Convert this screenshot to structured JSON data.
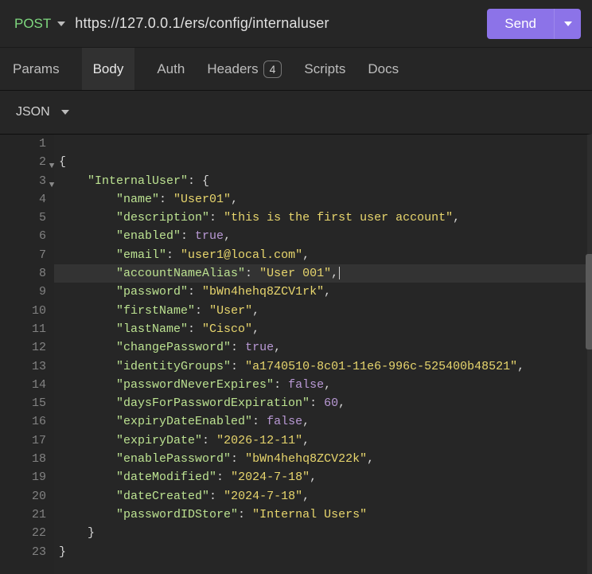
{
  "request": {
    "method": "POST",
    "url": "https://127.0.0.1/ers/config/internaluser",
    "sendLabel": "Send"
  },
  "tabs": {
    "params": "Params",
    "body": "Body",
    "auth": "Auth",
    "headers": "Headers",
    "headersBadge": "4",
    "scripts": "Scripts",
    "docs": "Docs",
    "active": "Body"
  },
  "formatBar": {
    "label": "JSON"
  },
  "editor": {
    "highlightedLine": 8,
    "lines": [
      {
        "num": 1,
        "indent": 0,
        "fold": null,
        "tokens": []
      },
      {
        "num": 2,
        "indent": 0,
        "fold": "▼",
        "tokens": [
          {
            "t": "pn",
            "v": "{"
          }
        ]
      },
      {
        "num": 3,
        "indent": 1,
        "fold": "▼",
        "tokens": [
          {
            "t": "key",
            "v": "\"InternalUser\""
          },
          {
            "t": "pn",
            "v": ": {"
          }
        ]
      },
      {
        "num": 4,
        "indent": 2,
        "fold": null,
        "tokens": [
          {
            "t": "key",
            "v": "\"name\""
          },
          {
            "t": "pn",
            "v": ": "
          },
          {
            "t": "str",
            "v": "\"User01\""
          },
          {
            "t": "pn",
            "v": ","
          }
        ]
      },
      {
        "num": 5,
        "indent": 2,
        "fold": null,
        "tokens": [
          {
            "t": "key",
            "v": "\"description\""
          },
          {
            "t": "pn",
            "v": ": "
          },
          {
            "t": "str",
            "v": "\"this is the first user account\""
          },
          {
            "t": "pn",
            "v": ","
          }
        ]
      },
      {
        "num": 6,
        "indent": 2,
        "fold": null,
        "tokens": [
          {
            "t": "key",
            "v": "\"enabled\""
          },
          {
            "t": "pn",
            "v": ": "
          },
          {
            "t": "kw",
            "v": "true"
          },
          {
            "t": "pn",
            "v": ","
          }
        ]
      },
      {
        "num": 7,
        "indent": 2,
        "fold": null,
        "tokens": [
          {
            "t": "key",
            "v": "\"email\""
          },
          {
            "t": "pn",
            "v": ": "
          },
          {
            "t": "str",
            "v": "\"user1@local.com\""
          },
          {
            "t": "pn",
            "v": ","
          }
        ]
      },
      {
        "num": 8,
        "indent": 2,
        "fold": null,
        "cursor": true,
        "tokens": [
          {
            "t": "key",
            "v": "\"accountNameAlias\""
          },
          {
            "t": "pn",
            "v": ": "
          },
          {
            "t": "str",
            "v": "\"User 001\""
          },
          {
            "t": "pn",
            "v": ","
          }
        ]
      },
      {
        "num": 9,
        "indent": 2,
        "fold": null,
        "tokens": [
          {
            "t": "key",
            "v": "\"password\""
          },
          {
            "t": "pn",
            "v": ": "
          },
          {
            "t": "str",
            "v": "\"bWn4hehq8ZCV1rk\""
          },
          {
            "t": "pn",
            "v": ","
          }
        ]
      },
      {
        "num": 10,
        "indent": 2,
        "fold": null,
        "tokens": [
          {
            "t": "key",
            "v": "\"firstName\""
          },
          {
            "t": "pn",
            "v": ": "
          },
          {
            "t": "str",
            "v": "\"User\""
          },
          {
            "t": "pn",
            "v": ","
          }
        ]
      },
      {
        "num": 11,
        "indent": 2,
        "fold": null,
        "tokens": [
          {
            "t": "key",
            "v": "\"lastName\""
          },
          {
            "t": "pn",
            "v": ": "
          },
          {
            "t": "str",
            "v": "\"Cisco\""
          },
          {
            "t": "pn",
            "v": ","
          }
        ]
      },
      {
        "num": 12,
        "indent": 2,
        "fold": null,
        "tokens": [
          {
            "t": "key",
            "v": "\"changePassword\""
          },
          {
            "t": "pn",
            "v": ": "
          },
          {
            "t": "kw",
            "v": "true"
          },
          {
            "t": "pn",
            "v": ","
          }
        ]
      },
      {
        "num": 13,
        "indent": 2,
        "fold": null,
        "tokens": [
          {
            "t": "key",
            "v": "\"identityGroups\""
          },
          {
            "t": "pn",
            "v": ": "
          },
          {
            "t": "str",
            "v": "\"a1740510-8c01-11e6-996c-525400b48521\""
          },
          {
            "t": "pn",
            "v": ","
          }
        ]
      },
      {
        "num": 14,
        "indent": 2,
        "fold": null,
        "tokens": [
          {
            "t": "key",
            "v": "\"passwordNeverExpires\""
          },
          {
            "t": "pn",
            "v": ": "
          },
          {
            "t": "kw",
            "v": "false"
          },
          {
            "t": "pn",
            "v": ","
          }
        ]
      },
      {
        "num": 15,
        "indent": 2,
        "fold": null,
        "tokens": [
          {
            "t": "key",
            "v": "\"daysForPasswordExpiration\""
          },
          {
            "t": "pn",
            "v": ": "
          },
          {
            "t": "num",
            "v": "60"
          },
          {
            "t": "pn",
            "v": ","
          }
        ]
      },
      {
        "num": 16,
        "indent": 2,
        "fold": null,
        "tokens": [
          {
            "t": "key",
            "v": "\"expiryDateEnabled\""
          },
          {
            "t": "pn",
            "v": ": "
          },
          {
            "t": "kw",
            "v": "false"
          },
          {
            "t": "pn",
            "v": ","
          }
        ]
      },
      {
        "num": 17,
        "indent": 2,
        "fold": null,
        "tokens": [
          {
            "t": "key",
            "v": "\"expiryDate\""
          },
          {
            "t": "pn",
            "v": ": "
          },
          {
            "t": "str",
            "v": "\"2026-12-11\""
          },
          {
            "t": "pn",
            "v": ","
          }
        ]
      },
      {
        "num": 18,
        "indent": 2,
        "fold": null,
        "tokens": [
          {
            "t": "key",
            "v": "\"enablePassword\""
          },
          {
            "t": "pn",
            "v": ": "
          },
          {
            "t": "str",
            "v": "\"bWn4hehq8ZCV22k\""
          },
          {
            "t": "pn",
            "v": ","
          }
        ]
      },
      {
        "num": 19,
        "indent": 2,
        "fold": null,
        "tokens": [
          {
            "t": "key",
            "v": "\"dateModified\""
          },
          {
            "t": "pn",
            "v": ": "
          },
          {
            "t": "str",
            "v": "\"2024-7-18\""
          },
          {
            "t": "pn",
            "v": ","
          }
        ]
      },
      {
        "num": 20,
        "indent": 2,
        "fold": null,
        "tokens": [
          {
            "t": "key",
            "v": "\"dateCreated\""
          },
          {
            "t": "pn",
            "v": ": "
          },
          {
            "t": "str",
            "v": "\"2024-7-18\""
          },
          {
            "t": "pn",
            "v": ","
          }
        ]
      },
      {
        "num": 21,
        "indent": 2,
        "fold": null,
        "tokens": [
          {
            "t": "key",
            "v": "\"passwordIDStore\""
          },
          {
            "t": "pn",
            "v": ": "
          },
          {
            "t": "str",
            "v": "\"Internal Users\""
          }
        ]
      },
      {
        "num": 22,
        "indent": 1,
        "fold": null,
        "tokens": [
          {
            "t": "pn",
            "v": "}"
          }
        ]
      },
      {
        "num": 23,
        "indent": 0,
        "fold": null,
        "tokens": [
          {
            "t": "pn",
            "v": "}"
          }
        ]
      }
    ]
  }
}
